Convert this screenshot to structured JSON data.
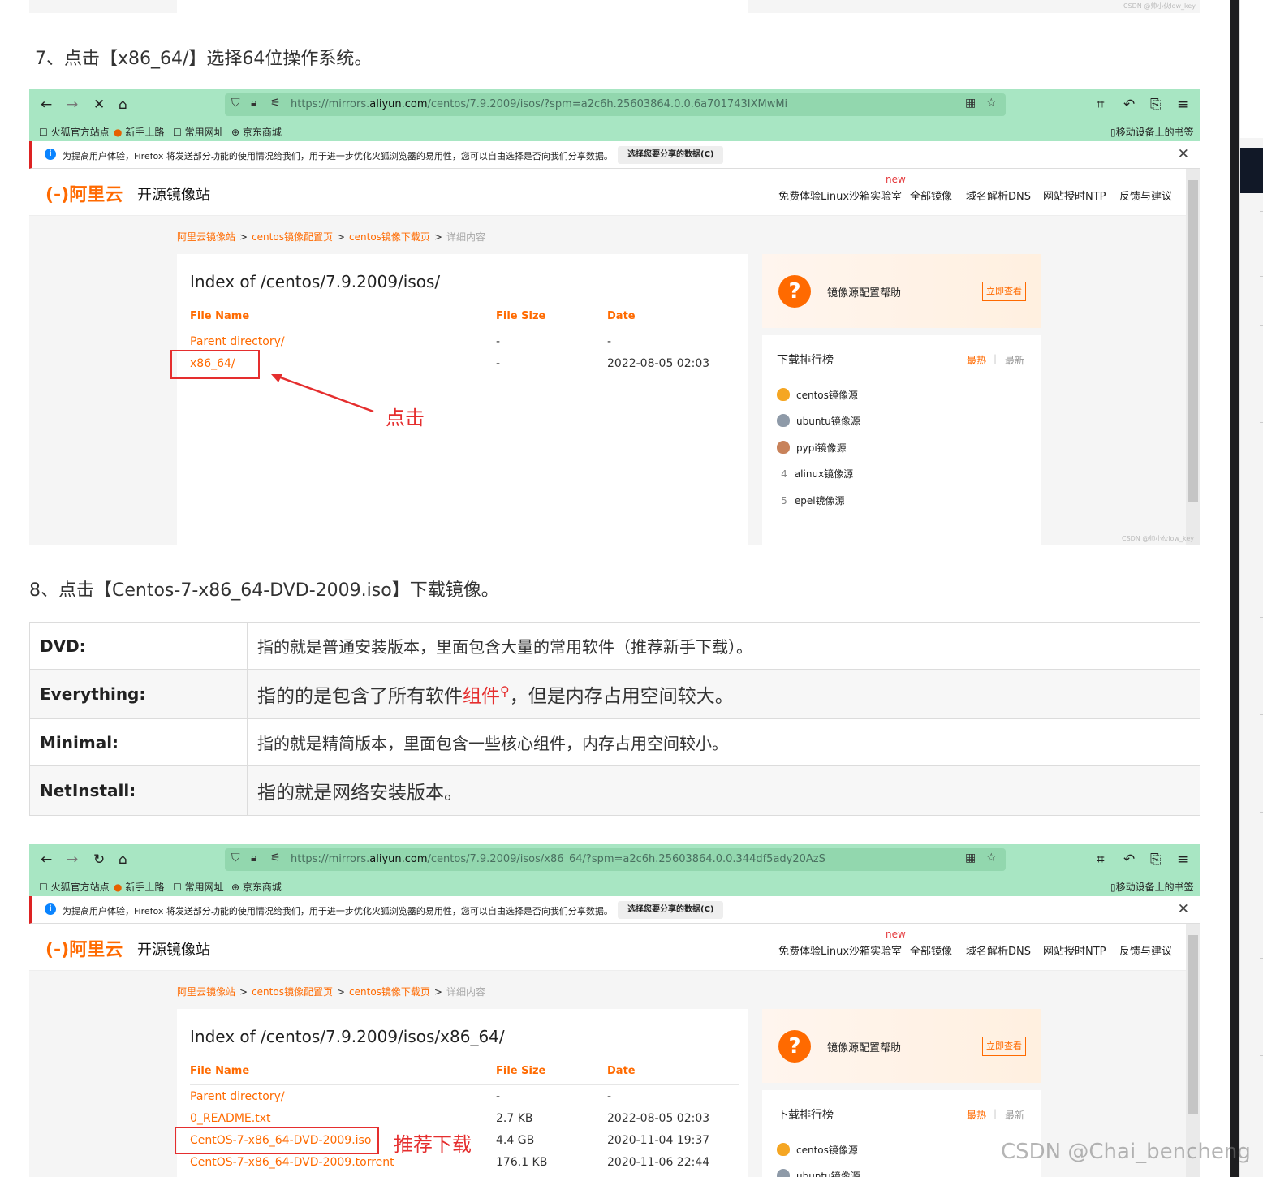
{
  "top_strip": {
    "watermark": "CSDN @帅小伙low_key"
  },
  "step7": "7、点击【x86_64/】选择64位操作系统。",
  "step8": "8、点击【Centos-7-x86_64-DVD-2009.iso】下载镜像。",
  "browser": {
    "bookmarks": [
      "火狐官方站点",
      "新手上路",
      "常用网址",
      "京东商城"
    ],
    "mobile_bookmarks": "移动设备上的书签",
    "notification": "为提高用户体验，Firefox 将发送部分功能的使用情况给我们，用于进一步优化火狐浏览器的易用性，您可以自由选择是否向我们分享数据。",
    "notification_button": "选择您要分享的数据(C)"
  },
  "site": {
    "logo": "(-)阿里云",
    "name": "开源镜像站",
    "new_tag": "new",
    "nav": [
      "免费体验Linux沙箱实验室",
      "全部镜像",
      "域名解析DNS",
      "网站授时NTP",
      "反馈与建议"
    ],
    "breadcrumb": [
      "阿里云镜像站",
      "centos镜像配置页",
      "centos镜像下载页",
      "详细内容"
    ],
    "breadcrumb_sep": ">",
    "help_title": "镜像源配置帮助",
    "help_button": "立即查看",
    "rank_title": "下载排行榜",
    "rank_hot": "最热",
    "rank_new": "最新",
    "rank_items": [
      "centos镜像源",
      "ubuntu镜像源",
      "pypi镜像源",
      "alinux镜像源",
      "epel镜像源"
    ],
    "rank_nums": [
      "",
      "",
      "",
      "4",
      "5"
    ],
    "columns": [
      "File Name",
      "File Size",
      "Date"
    ]
  },
  "shot1": {
    "url_prefix": "https://mirrors.",
    "url_domain": "aliyun.com",
    "url_path": "/centos/7.9.2009/isos/?spm=a2c6h.25603864.0.0.6a701743IXMwMi",
    "title": "Index of /centos/7.9.2009/isos/",
    "rows": [
      {
        "name": "Parent directory/",
        "size": "-",
        "date": "-"
      },
      {
        "name": "x86_64/",
        "size": "-",
        "date": "2022-08-05 02:03"
      }
    ],
    "annotation": "点击",
    "watermark": "CSDN @帅小伙low_key"
  },
  "shot2": {
    "url_prefix": "https://mirrors.",
    "url_domain": "aliyun.com",
    "url_path": "/centos/7.9.2009/isos/x86_64/?spm=a2c6h.25603864.0.0.344df5ady20AzS",
    "title": "Index of /centos/7.9.2009/isos/x86_64/",
    "rows": [
      {
        "name": "Parent directory/",
        "size": "-",
        "date": "-"
      },
      {
        "name": "0_README.txt",
        "size": "2.7 KB",
        "date": "2022-08-05 02:03"
      },
      {
        "name": "CentOS-7-x86_64-DVD-2009.iso",
        "size": "4.4 GB",
        "date": "2020-11-04 19:37"
      },
      {
        "name": "CentOS-7-x86_64-DVD-2009.torrent",
        "size": "176.1 KB",
        "date": "2020-11-06 22:44"
      }
    ],
    "annotation": "推荐下载"
  },
  "desc_table": [
    {
      "key": "DVD:",
      "value": "指的就是普通安装版本，里面包含大量的常用软件（推荐新手下载）。"
    },
    {
      "key": "Everything:",
      "value_before": "指的的是包含了所有软件",
      "value_link": "组件",
      "value_after": "，但是内存占用空间较大。"
    },
    {
      "key": "Minimal:",
      "value": "指的就是精简版本，里面包含一些核心组件，内存占用空间较小。"
    },
    {
      "key": "NetInstall:",
      "value": "指的就是网络安装版本。"
    }
  ],
  "watermark": "CSDN @Chai_bencheng",
  "colors": {
    "accent": "#ff6a00",
    "annotation": "#e52e2e",
    "browser_bar": "#a8e6c3"
  }
}
